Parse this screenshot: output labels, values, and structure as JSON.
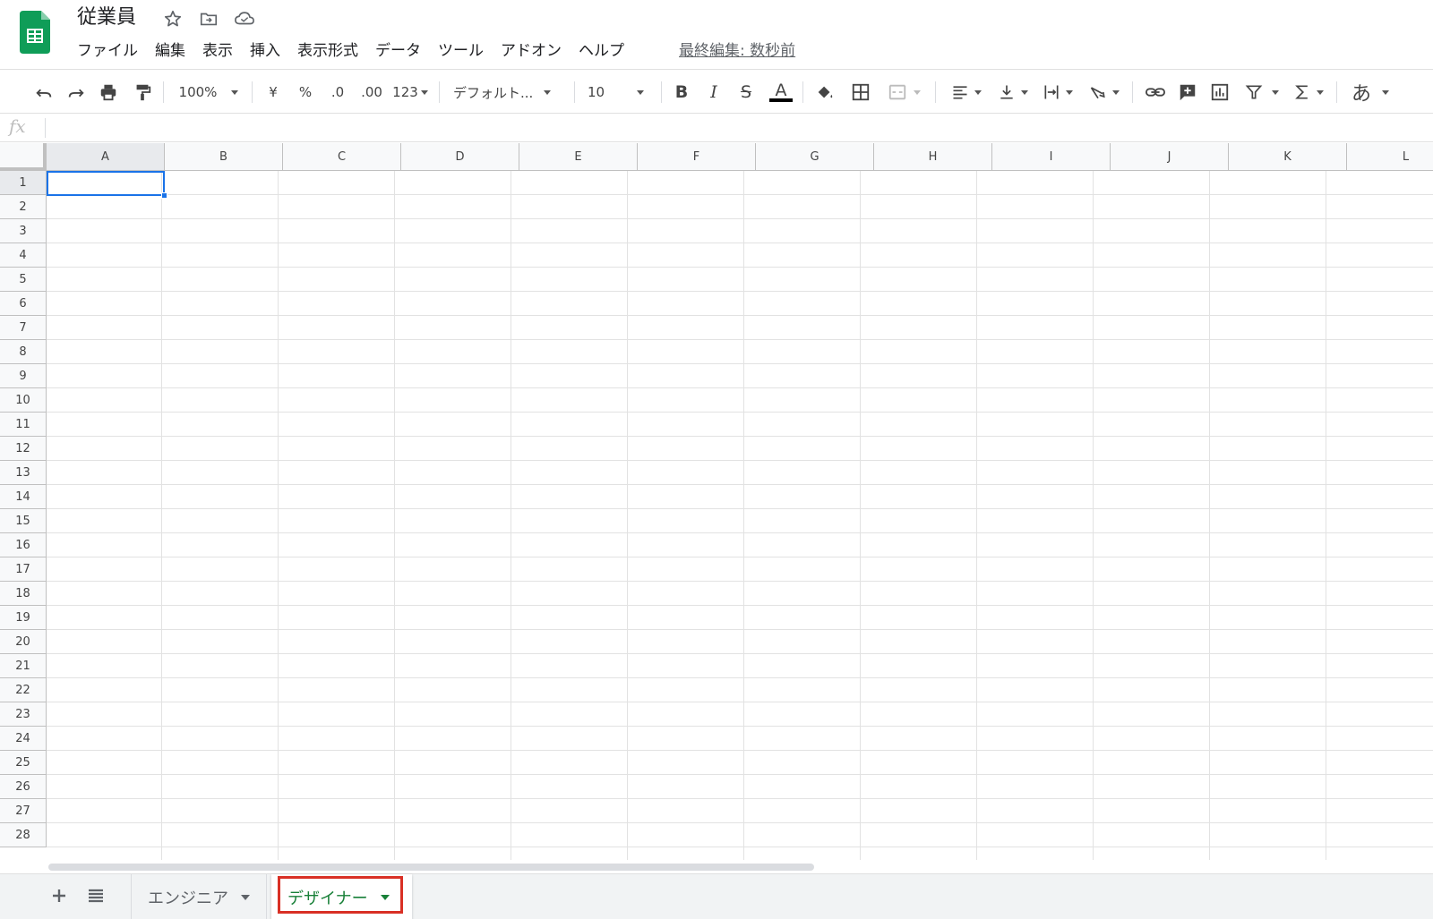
{
  "document": {
    "title": "従業員",
    "last_edit": "最終編集: 数秒前"
  },
  "menu": [
    "ファイル",
    "編集",
    "表示",
    "挿入",
    "表示形式",
    "データ",
    "ツール",
    "アドオン",
    "ヘルプ"
  ],
  "toolbar": {
    "zoom": "100%",
    "currency": "¥",
    "percent": "%",
    "decrease_decimal": ".0",
    "increase_decimal": ".00",
    "number_format": "123",
    "font": "デフォルト...",
    "font_size": "10",
    "bold": "B",
    "italic": "I",
    "strike": "S",
    "text_color": "A",
    "input_tools": "あ"
  },
  "formula_bar": {
    "label": "fx",
    "value": ""
  },
  "grid": {
    "columns": [
      "A",
      "B",
      "C",
      "D",
      "E",
      "F",
      "G",
      "H",
      "I",
      "J",
      "K",
      "L"
    ],
    "rows": [
      "1",
      "2",
      "3",
      "4",
      "5",
      "6",
      "7",
      "8",
      "9",
      "10",
      "11",
      "12",
      "13",
      "14",
      "15",
      "16",
      "17",
      "18",
      "19",
      "20",
      "21",
      "22",
      "23",
      "24",
      "25",
      "26",
      "27",
      "28"
    ],
    "selected_cell": "A1"
  },
  "sheets": {
    "tabs": [
      "エンジニア",
      "デザイナー"
    ],
    "active": "デザイナー"
  },
  "colors": {
    "accent": "#1a73e8",
    "sheets_green": "#188038",
    "highlight_red": "#d93025"
  }
}
